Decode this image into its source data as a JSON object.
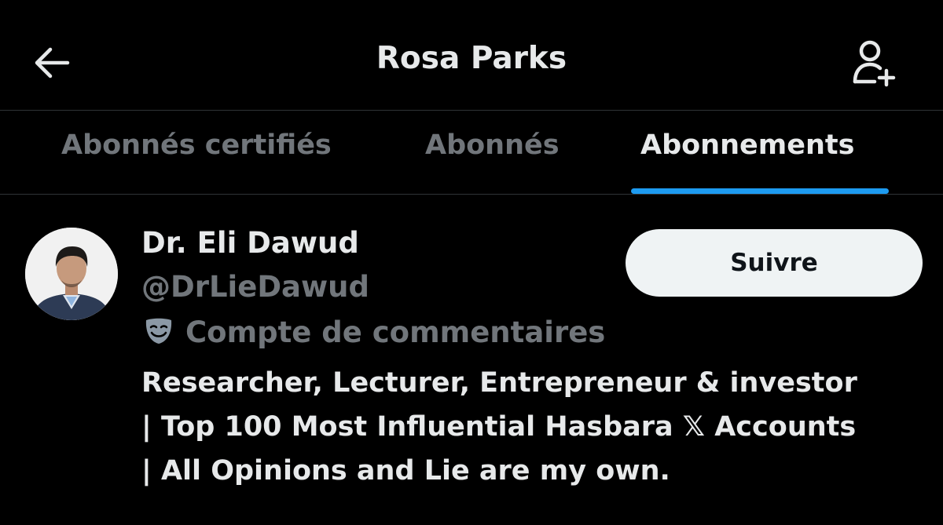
{
  "header": {
    "title": "Rosa Parks",
    "back_icon": "arrow-left-icon",
    "add_user_icon": "person-plus-icon"
  },
  "tabs": [
    {
      "label": "Abonnés certifiés",
      "active": false
    },
    {
      "label": "Abonnés",
      "active": false
    },
    {
      "label": "Abonnements",
      "active": true
    }
  ],
  "colors": {
    "background": "#000000",
    "primary_text": "#e7e9ea",
    "secondary_text": "#71767b",
    "accent": "#1d9bf0",
    "divider": "#2f3336",
    "button_bg": "#eff3f4",
    "button_text": "#0f1419"
  },
  "user": {
    "display_name": "Dr. Eli Dawud",
    "handle": "@DrLieDawud",
    "label_icon": "theater-masks-icon",
    "label": "Compte de commentaires",
    "follow_label": "Suivre",
    "bio_lines": [
      "Researcher, Lecturer, Entrepreneur & investor",
      "| Top 100 Most Influential Hasbara 𝕏 Accounts",
      "| All Opinions and Lie are my own."
    ]
  }
}
